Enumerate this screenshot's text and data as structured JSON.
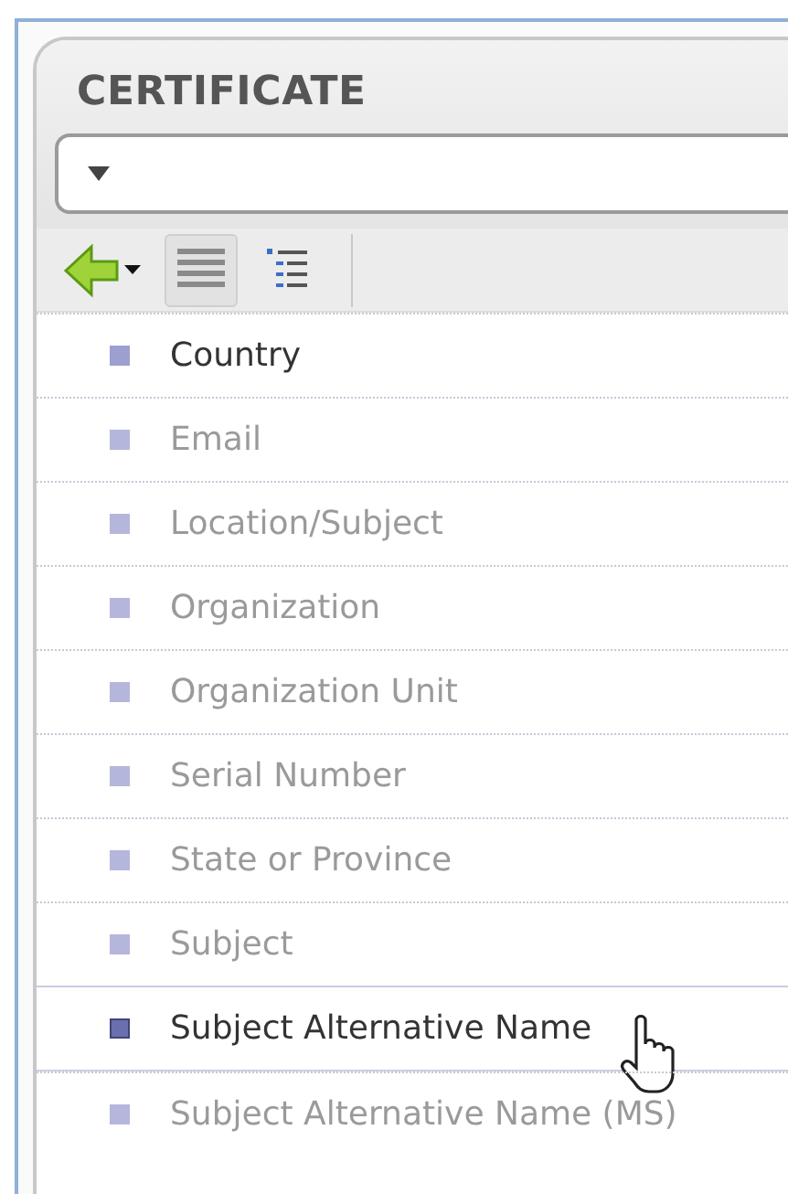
{
  "panel": {
    "title": "CERTIFICATE"
  },
  "toolbar": {
    "buttons": [
      {
        "kind": "back",
        "selected": false
      },
      {
        "kind": "list",
        "selected": true
      },
      {
        "kind": "tree",
        "selected": false
      }
    ]
  },
  "items": [
    {
      "name": "Country",
      "blurred": false,
      "selected": false
    },
    {
      "name": "Email",
      "blurred": true,
      "selected": false
    },
    {
      "name": "Location/Subject",
      "blurred": true,
      "selected": false
    },
    {
      "name": "Organization",
      "blurred": true,
      "selected": false
    },
    {
      "name": "Organization Unit",
      "blurred": true,
      "selected": false
    },
    {
      "name": "Serial Number",
      "blurred": true,
      "selected": false
    },
    {
      "name": "State or Province",
      "blurred": true,
      "selected": false
    },
    {
      "name": "Subject",
      "blurred": true,
      "selected": false
    },
    {
      "name": "Subject Alternative Name",
      "blurred": false,
      "selected": true
    },
    {
      "name": "Subject Alternative Name (MS)",
      "blurred": true,
      "selected": false
    }
  ]
}
